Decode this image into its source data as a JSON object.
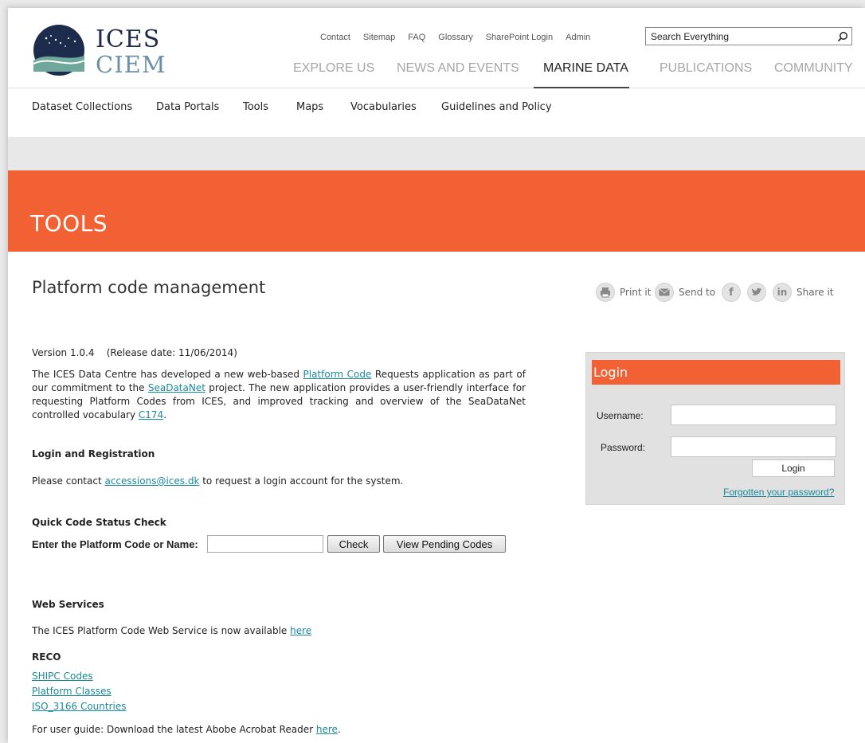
{
  "logo": {
    "line1": "ICES",
    "line2": "CIEM"
  },
  "utility_links": [
    "Contact",
    "Sitemap",
    "FAQ",
    "Glossary",
    "SharePoint Login",
    "Admin"
  ],
  "search": {
    "placeholder": "Search Everything"
  },
  "main_nav": [
    "EXPLORE US",
    "NEWS AND EVENTS",
    "MARINE DATA",
    "PUBLICATIONS",
    "COMMUNITY"
  ],
  "main_nav_active": "MARINE DATA",
  "sub_nav": [
    "Dataset Collections",
    "Data Portals",
    "Tools",
    "Maps",
    "Vocabularies",
    "Guidelines and Policy"
  ],
  "banner_title": "TOOLS",
  "page_title": "Platform code management",
  "share": {
    "print": "Print it",
    "send": "Send to",
    "share": "Share it"
  },
  "version": "Version 1.0.4    (Release date: 11/06/2014)",
  "intro": {
    "t1": "The ICES Data Centre has developed a new web-based ",
    "link1": "Platform Code",
    "t2": " Requests application as part of our commitment to the ",
    "link2": "SeaDataNet",
    "t3": " project. The new application provides a user-friendly interface for requesting Platform Codes from ICES, and improved tracking and overview of the SeaDataNet controlled vocabulary ",
    "link3": "C174",
    "t4": "."
  },
  "login_reg": {
    "heading": "Login and Registration",
    "pre": "Please contact ",
    "email": "accessions@ices.dk",
    "post": " to request a login account for the system."
  },
  "quick_check": {
    "heading": "Quick Code Status Check",
    "label": "Enter the Platform Code or Name:",
    "value": "",
    "check": "Check",
    "pending": "View Pending Codes"
  },
  "web_services": {
    "heading": "Web Services",
    "pre": "The ICES Platform Code Web Service is now available ",
    "link": "here"
  },
  "reco": {
    "heading": "RECO",
    "links": [
      "SHIPC Codes",
      "Platform Classes",
      "ISO_3166 Countries"
    ]
  },
  "guide": {
    "pre": "For user guide: Download the latest Abobe Acrobat Reader ",
    "link": "here",
    "post": "."
  },
  "login_box": {
    "title": "Login",
    "username_label": "Username:",
    "password_label": "Password:",
    "username_value": "",
    "password_value": "",
    "button": "Login",
    "forgot": "Forgotten your password?"
  },
  "colors": {
    "accent": "#f26133",
    "link": "#1a8a9a",
    "navy": "#1d2c4c"
  }
}
